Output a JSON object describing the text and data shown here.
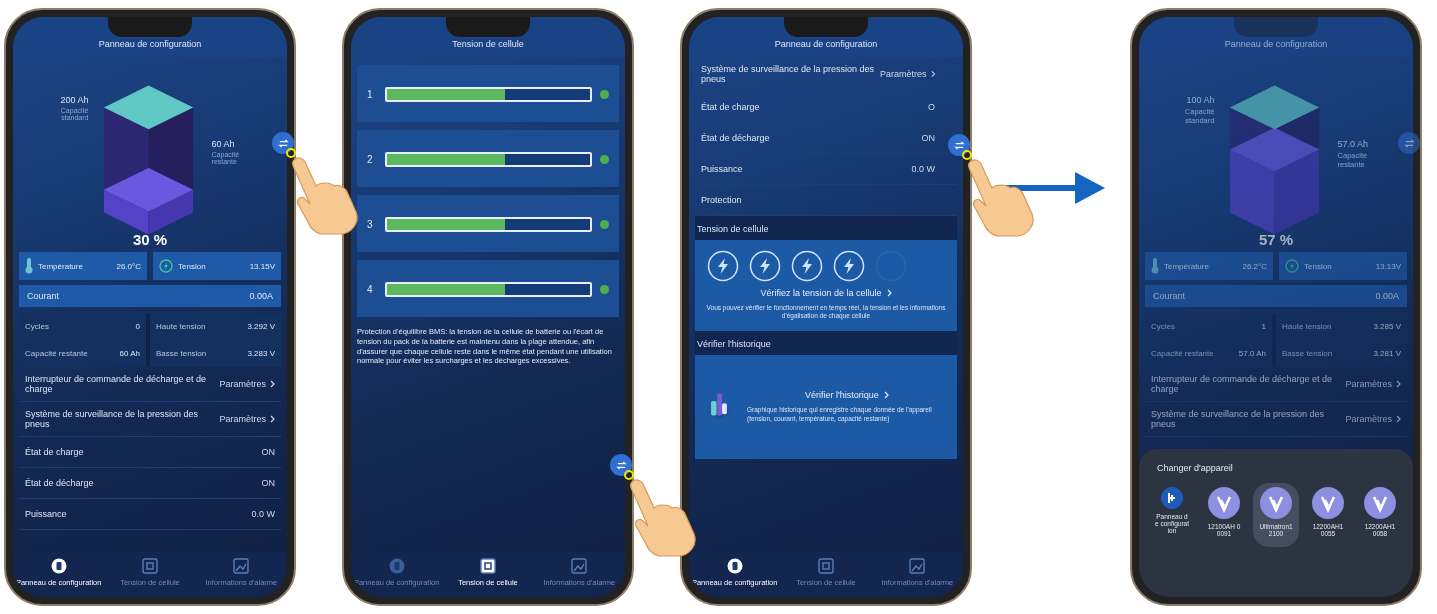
{
  "screens": [
    {
      "kind": "dashboard",
      "title": "Panneau de configuration",
      "dimmed": false,
      "switch_button": {
        "tapped": true
      },
      "battery": {
        "total": "200 Ah",
        "total_label": "Capacité standard",
        "remaining": "60 Ah",
        "remaining_label": "Capacité restante",
        "percent": "30 %",
        "level": 0.3
      },
      "temperature": {
        "label": "Température",
        "value": "26.0°C"
      },
      "voltage": {
        "label": "Tension",
        "value": "13.15V"
      },
      "current": {
        "label": "Courant",
        "value": "0.00A"
      },
      "stats": [
        {
          "label": "Cycles",
          "value": "0"
        },
        {
          "label": "Haute tension",
          "value": "3.292 V"
        },
        {
          "label": "Capacité restante",
          "value": "60 Ah"
        },
        {
          "label": "Basse tension",
          "value": "3.283 V"
        }
      ],
      "rows": [
        {
          "kind": "link",
          "label": "Interrupteur de commande de décharge et de charge",
          "value": "Paramètres"
        },
        {
          "kind": "link",
          "label": "Système de surveillance de la pression des pneus",
          "value": "Paramètres"
        },
        {
          "kind": "value",
          "label": "État de charge",
          "value": "ON"
        },
        {
          "kind": "value",
          "label": "État de décharge",
          "value": "ON"
        },
        {
          "kind": "value",
          "label": "Puissance",
          "value": "0.0 W"
        }
      ],
      "nav": [
        {
          "kind": "battery",
          "label": "Panneau de configuration",
          "selected": true
        },
        {
          "kind": "cells",
          "label": "Tension de cellule",
          "selected": false
        },
        {
          "kind": "alarm",
          "label": "Informations d'alarme",
          "selected": false
        }
      ]
    },
    {
      "kind": "cells",
      "title": "Tension de cellule",
      "switch_button": {
        "tapped": true
      },
      "cells": [
        {
          "number": "1",
          "level": 0.58
        },
        {
          "number": "2",
          "level": 0.58
        },
        {
          "number": "3",
          "level": 0.58
        },
        {
          "number": "4",
          "level": 0.58
        }
      ],
      "description": "Protection d'équilibre BMS: la tension de la cellule de batterie ou l'écart de tension du pack de la batterie est maintenu dans la plage attendue, afin d'assurer que chaque cellule reste dans le même état pendant une utilisation normale pour éviter les surcharges et les décharges excessives.",
      "nav": [
        {
          "kind": "battery",
          "label": "Panneau de configuration",
          "selected": false
        },
        {
          "kind": "cells",
          "label": "Tension de cellule",
          "selected": true
        },
        {
          "kind": "alarm",
          "label": "Informations d'alarme",
          "selected": false
        }
      ]
    },
    {
      "kind": "overview",
      "title": "Panneau de configuration",
      "switch_button": {
        "tapped": true
      },
      "rows": [
        {
          "kind": "link",
          "label": "Système de surveillance de la pression des pneus",
          "value": "Paramètres"
        },
        {
          "kind": "value",
          "label": "État de charge",
          "value": "O"
        },
        {
          "kind": "value",
          "label": "État de décharge",
          "value": "ON"
        },
        {
          "kind": "value",
          "label": "Puissance",
          "value": "0.0 W"
        },
        {
          "kind": "value",
          "label": "Protection"
        }
      ],
      "cell_section": {
        "heading": "Tension de cellule",
        "cells": [
          {
            "active": true
          },
          {
            "active": true
          },
          {
            "active": true
          },
          {
            "active": true
          },
          {
            "active": false
          }
        ],
        "link": "Vérifiez la tension de la cellule",
        "description": "Vous pouvez vérifier le fonctionnement en temps réel, la tension et les informations d'égalisation de chaque cellule"
      },
      "history_section": {
        "heading": "Vérifier l'historique",
        "link": "Vérifier l'historique",
        "description": "Graphique historique qui enregistre chaque donnée de l'appareil (tension, courant, température, capacité restante)"
      },
      "nav": [
        {
          "kind": "battery",
          "label": "Panneau de configuration",
          "selected": true
        },
        {
          "kind": "cells",
          "label": "Tension de cellule",
          "selected": false
        },
        {
          "kind": "alarm",
          "label": "Informations d'alarme",
          "selected": false
        }
      ]
    },
    {
      "kind": "dashboard",
      "title": "Panneau de configuration",
      "dimmed": true,
      "switch_button": {
        "tapped": false
      },
      "battery": {
        "total": "100 Ah",
        "total_label": "Capacité standard",
        "remaining": "57.0 Ah",
        "remaining_label": "Capacité restante",
        "percent": "57 %",
        "level": 0.57
      },
      "temperature": {
        "label": "Température",
        "value": "26.2°C"
      },
      "voltage": {
        "label": "Tension",
        "value": "13.13V"
      },
      "current": {
        "label": "Courant",
        "value": "0.00A"
      },
      "stats": [
        {
          "label": "Cycles",
          "value": "1"
        },
        {
          "label": "Haute tension",
          "value": "3.285 V"
        },
        {
          "label": "Capacité restante",
          "value": "57.0 Ah"
        },
        {
          "label": "Basse tension",
          "value": "3.281 V"
        }
      ],
      "rows": [
        {
          "kind": "link",
          "label": "Interrupteur de commande de décharge et de charge",
          "value": "Paramètres"
        },
        {
          "kind": "link",
          "label": "Système de surveillance de la pression des pneus",
          "value": "Paramètres"
        }
      ],
      "sheet": {
        "title": "Changer d'appareil",
        "devices": [
          {
            "kind": "panel",
            "label": "Panneau de configuration",
            "selected": false
          },
          {
            "kind": "device",
            "label": "12100AH 00091",
            "selected": false
          },
          {
            "kind": "device",
            "label": "Ultimatron12100",
            "selected": true
          },
          {
            "kind": "device",
            "label": "12200AH10055",
            "selected": false
          },
          {
            "kind": "device",
            "label": "12200AH10058",
            "selected": false
          }
        ]
      }
    }
  ]
}
